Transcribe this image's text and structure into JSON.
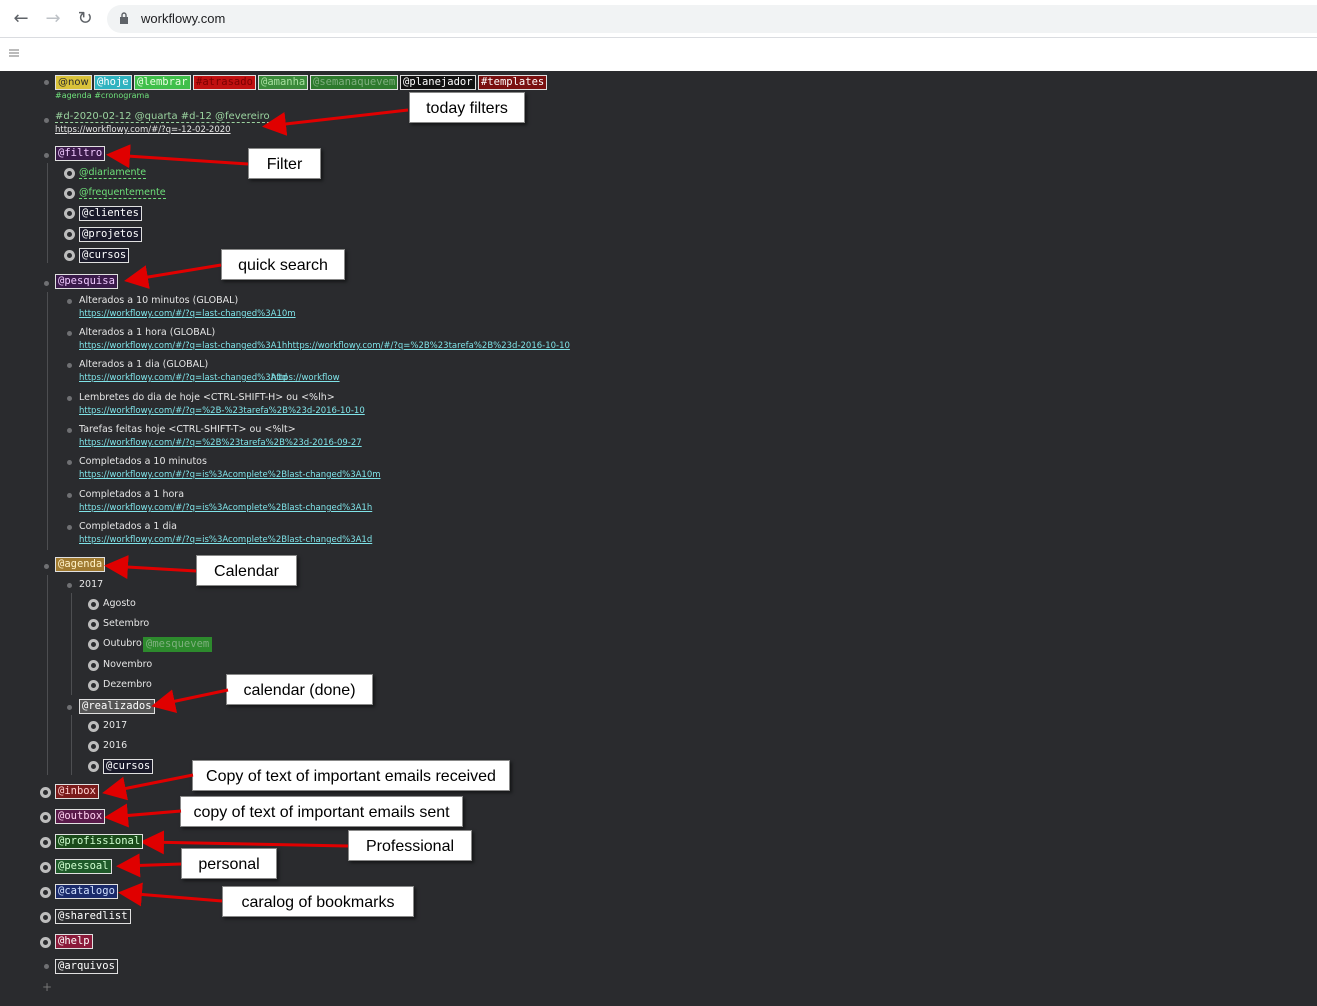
{
  "browser": {
    "url": "workflowy.com",
    "back_icon": "arrow-left-icon",
    "forward_icon": "arrow-right-icon",
    "reload_icon": "reload-icon"
  },
  "header_tags": [
    "@now",
    "@hoje",
    "@lembrar",
    "#atrasado",
    "@amanha",
    "@semanaquevem",
    "@planejador",
    "#templates"
  ],
  "header_sub": "#agenda #cronograma",
  "today": {
    "text": "#d-2020-02-12 @quarta #d-12 @fevereiro",
    "link": "https://workflowy.com/#/?q=-12-02-2020"
  },
  "filtro": {
    "label": "@filtro",
    "items": [
      "@diariamente",
      "@frequentemente",
      "@clientes",
      "@projetos",
      "@cursos"
    ]
  },
  "pesquisa": {
    "label": "@pesquisa",
    "items": [
      {
        "title": "Alterados a 10 minutos (GLOBAL)",
        "link": "https://workflowy.com/#/?q=last-changed%3A10m"
      },
      {
        "title": "Alterados a 1 hora (GLOBAL)",
        "link": "https://workflowy.com/#/?q=last-changed%3A1hhttps://workflowy.com/#/?q=%2B%23tarefa%2B%23d-2016-10-10"
      },
      {
        "title": "Alterados a 1 dia (GLOBAL)",
        "link": "https://workflowy.com/#/?q=last-changed%3A1d",
        "link2": "https://workflow"
      },
      {
        "title": "Lembretes do dia de hoje <CTRL-SHIFT-H> ou <%lh>",
        "link": "https://workflowy.com/#/?q=%2B-%23tarefa%2B%23d-2016-10-10"
      },
      {
        "title": "Tarefas feitas hoje <CTRL-SHIFT-T> ou <%lt>",
        "link": "https://workflowy.com/#/?q=%2B%23tarefa%2B%23d-2016-09-27"
      },
      {
        "title": "Completados a 10 minutos",
        "link": "https://workflowy.com/#/?q=is%3Acomplete%2Blast-changed%3A10m"
      },
      {
        "title": "Completados a 1 hora",
        "link": "https://workflowy.com/#/?q=is%3Acomplete%2Blast-changed%3A1h"
      },
      {
        "title": "Completados a 1 dia",
        "link": "https://workflowy.com/#/?q=is%3Acomplete%2Blast-changed%3A1d"
      }
    ]
  },
  "agenda": {
    "label": "@agenda",
    "year": "2017",
    "months": [
      "Agosto",
      "Setembro",
      "Outubro",
      "Novembro",
      "Dezembro"
    ],
    "outubro_tag": "@mesquevem",
    "realizados": "@realizados",
    "done": [
      "2017",
      "2016",
      "@cursos"
    ]
  },
  "top_items": [
    "@inbox",
    "@outbox",
    "@profissional",
    "@pessoal",
    "@catalogo",
    "@sharedlist",
    "@help",
    "@arquivos"
  ],
  "add_icon": "+",
  "callouts": {
    "today_filters": "today filters",
    "filter": "Filter",
    "quick_search": "quick search",
    "calendar": "Calendar",
    "calendar_done": "calendar (done)",
    "inbox": "Copy of text of important emails received",
    "outbox": "copy of text of important emails sent",
    "professional": "Professional",
    "personal": "personal",
    "catalog": "caralog of bookmarks"
  },
  "colors": {
    "background": "#2a2b2e",
    "arrow": "#e00000",
    "link": "#7fe3e8",
    "green_text": "#6ee07a"
  }
}
